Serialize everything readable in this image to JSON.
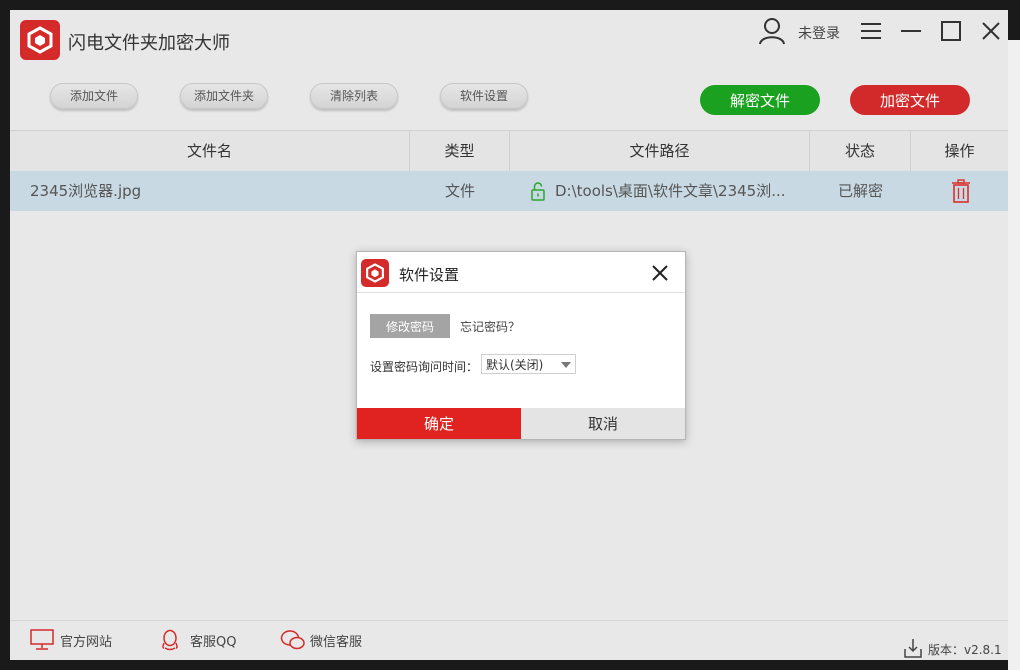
{
  "window": {
    "title": "闪电文件夹加密大师",
    "login_status": "未登录"
  },
  "toolbar": {
    "add_file": "添加文件",
    "add_folder": "添加文件夹",
    "clear_list": "清除列表",
    "settings": "软件设置",
    "decrypt": "解密文件",
    "encrypt": "加密文件"
  },
  "table": {
    "headers": [
      "文件名",
      "类型",
      "文件路径",
      "状态",
      "操作"
    ],
    "rows": [
      {
        "name": "2345浏览器.jpg",
        "type": "文件",
        "path": "D:\\tools\\桌面\\软件文章\\2345浏...",
        "status": "已解密"
      }
    ]
  },
  "footer": {
    "site": "官方网站",
    "qq": "客服QQ",
    "wechat": "微信客服",
    "version": "版本：v2.8.1"
  },
  "dialog": {
    "title": "软件设置",
    "change_password": "修改密码",
    "forgot_password": "忘记密码？",
    "ask_interval_label": "设置密码询问时间：",
    "ask_interval_value": "默认(关闭)",
    "ok": "确定",
    "cancel": "取消"
  },
  "colors": {
    "brand_red": "#d42a2a",
    "decrypt_green": "#1aa11f",
    "confirm_red": "#e02320",
    "row_selected": "#c8d9e3"
  }
}
